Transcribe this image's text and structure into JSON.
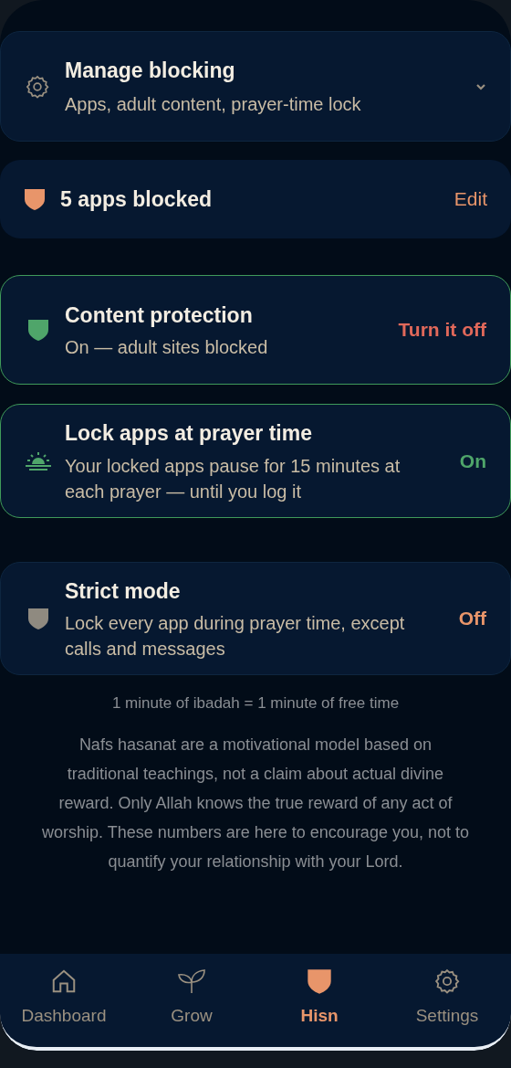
{
  "manage": {
    "title": "Manage blocking",
    "subtitle": "Apps, adult content, prayer-time lock",
    "expanded": false
  },
  "blocked": {
    "label": "5 apps blocked",
    "action": "Edit"
  },
  "toggles": [
    {
      "kind": "content",
      "title": "Content protection",
      "subtitle": "On — adult sites blocked",
      "on": true,
      "action": "Turn it off"
    },
    {
      "kind": "prayer",
      "title": "Lock apps at prayer time",
      "subtitle": "Your locked apps pause for 15 minutes at each prayer — until you log it",
      "on": true,
      "action": "On"
    },
    {
      "kind": "strict",
      "title": "Strict mode",
      "subtitle": "Lock every app during prayer time, except calls and messages",
      "on": false,
      "action": "Off"
    }
  ],
  "ratio_note": "1 minute of ibadah = 1 minute of free time",
  "disclaimer": "Nafs hasanat are a motivational model based on traditional teachings, not a claim about actual divine reward. Only Allah knows the true reward of any act of worship. These numbers are here to encourage you, not to quantify your relationship with your Lord.",
  "nav": [
    {
      "kind": "home",
      "label": "Dashboard",
      "selected": false
    },
    {
      "kind": "grow",
      "label": "Grow",
      "selected": false
    },
    {
      "kind": "hisn",
      "label": "Hisn",
      "selected": true
    },
    {
      "kind": "settings",
      "label": "Settings",
      "selected": false
    }
  ]
}
